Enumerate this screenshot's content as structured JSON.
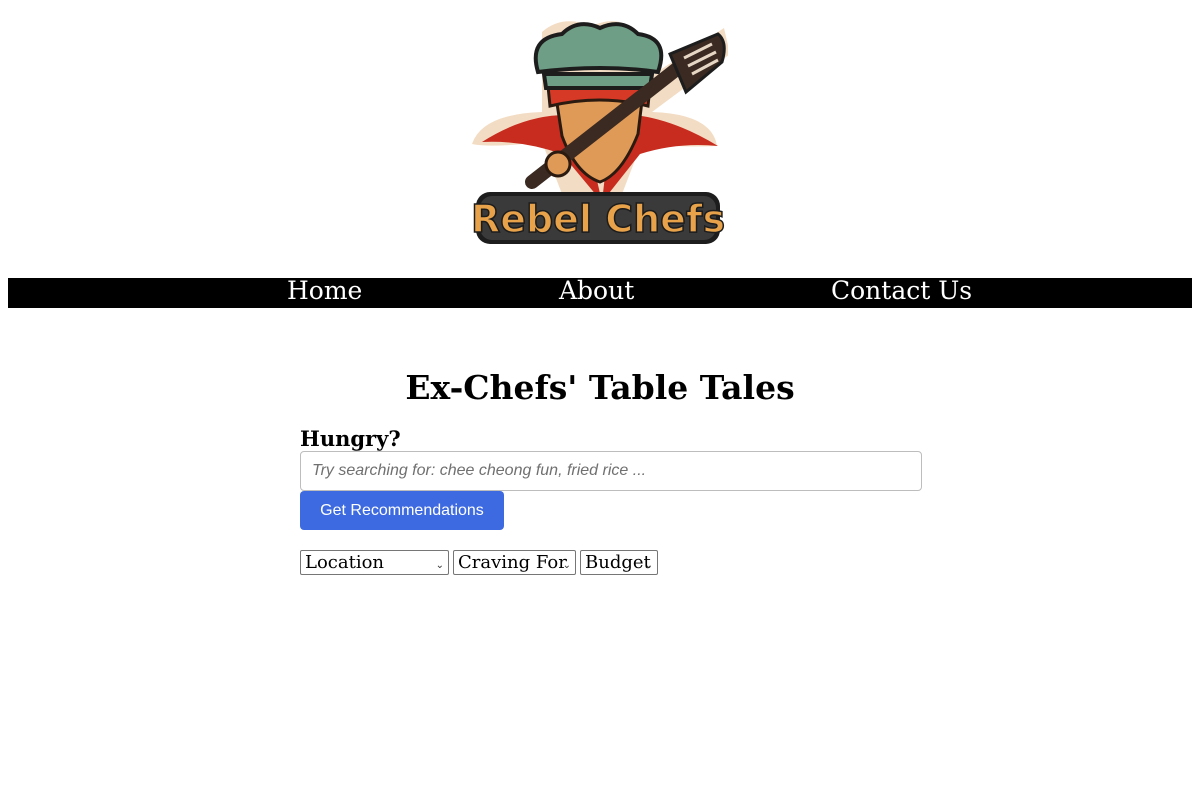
{
  "brand": {
    "logo_text": "Rebel Chefs",
    "colors": {
      "hat": "#6e9e86",
      "bandana": "#d63a26",
      "text": "#e7a24a",
      "outline": "#1d1d1d"
    }
  },
  "nav": {
    "items": [
      {
        "label": "Home"
      },
      {
        "label": "About"
      },
      {
        "label": "Contact Us"
      }
    ],
    "background": "#000000",
    "text_color": "#ffffff"
  },
  "main": {
    "title": "Ex-Chefs' Table Tales",
    "search": {
      "label": "Hungry?",
      "placeholder": "Try searching for: chee cheong fun, fried rice ...",
      "value": ""
    },
    "button": {
      "label": "Get Recommendations",
      "color": "#3d6ae0"
    },
    "filters": [
      {
        "label": "Location"
      },
      {
        "label": "Craving For"
      },
      {
        "label": "Budget"
      }
    ]
  }
}
